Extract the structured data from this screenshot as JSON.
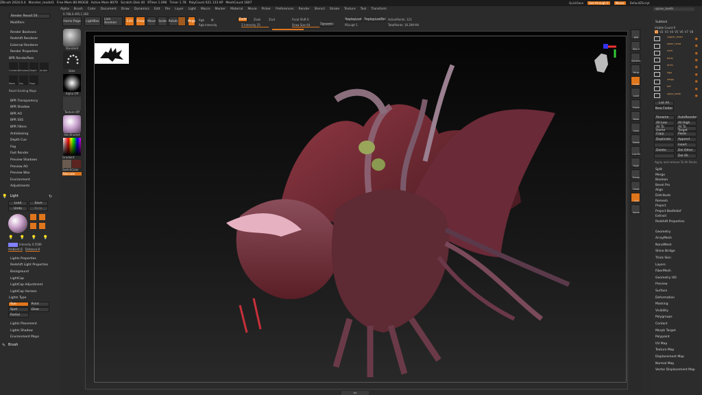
{
  "title_bar": {
    "items": [
      "ZBrush 2024.0.4",
      "Monster_model1",
      "Free Mem 80.993GB",
      "Active Mem 8079",
      "Scratch Disk 40",
      "RTime 1.096",
      "Timer 1.78",
      "PolyCount 621.133 KP",
      "MeshCount 1807"
    ],
    "right": [
      "QuickSave",
      "See-through 0",
      "Menus",
      "DefaultZScript"
    ]
  },
  "menubar": [
    "Alpha",
    "Brush",
    "Color",
    "Document",
    "Draw",
    "Dynamics",
    "Edit",
    "File",
    "Layer",
    "Light",
    "Macro",
    "Marker",
    "Material",
    "Movie",
    "Picker",
    "Preferences",
    "Render",
    "Stencil",
    "Stroke",
    "Texture",
    "Tool",
    "Transform",
    "ZPlugin",
    "ZScript",
    "Help"
  ],
  "coords": "0.768,0.495,1.268",
  "toolbar": {
    "home_page": "Home Page",
    "lightbox": "LightBox",
    "live_boolean": "Live Boolean",
    "edit": "Edit",
    "draw": "Draw",
    "move": "Move",
    "scale": "Scale",
    "rotate": "Rotate",
    "mrgb": "Mrgb",
    "rgb": "Rgb",
    "m": "M",
    "zadd": "Zadd",
    "zsub": "Zsub",
    "zcut": "Zcut",
    "rgb_intensity": "Rgb Intensity",
    "z_intensity": "Z Intensity 25",
    "focal_shift": "Focal Shift 0",
    "draw_size": "Draw Size 64",
    "dynamic": "Dynamic",
    "replay_last": "ReplayLast",
    "replay_last_rel": "ReplayLastRel",
    "polypaint": "PSculpt 1",
    "active_points": "ActivePoints: 121",
    "total_points": "TotalPoints: 16.299 Mil"
  },
  "left_panel": {
    "top_label": "Render Result 50",
    "modifiers": "Modifiers",
    "items_a": [
      "Render Booleans",
      "Redshift Renderer",
      "External Renderer",
      "Render Properties"
    ],
    "bpr_renderpass": "BPR RenderPass",
    "bpr_items": [
      "Combine",
      "Shadow",
      "Depth",
      "Ambie",
      "Mask",
      "Sss",
      "Floor",
      "Reset Existing Maps"
    ],
    "items_b": [
      "BPR Transparency",
      "BPR Shadow",
      "BPR AO",
      "BPR SSS",
      "BPR Filters",
      "Antialiasing",
      "Depth Cue",
      "Fog",
      "Fast Render",
      "Preview Shadows",
      "Preview AO",
      "Preview Wax",
      "Environment",
      "Adjustments"
    ],
    "light_title": "Light",
    "light_load": "Load",
    "light_save": "Save",
    "light_undo": "Undo",
    "light_redo": "Redo",
    "intensity": "Intensity 0.5589",
    "ambient": "Ambient 8",
    "distance": "Distance 8",
    "items_c": [
      "Lights Properties",
      "Redshift Light Properties",
      "Background",
      "LightCap",
      "LightCap Adjustment",
      "LightCap Horizon"
    ],
    "lights_type": "Lights Type",
    "type_buttons": [
      "Sun",
      "Point",
      "Spot",
      "Glow",
      "Radial"
    ],
    "items_d": [
      "Lights Placement",
      "Lights Shadow",
      "Environment Maps"
    ],
    "brush_title": "Brush"
  },
  "shelf": {
    "brush": "Standard",
    "stroke": "Dots",
    "alpha": "Alpha Off",
    "texture": "Texture Off",
    "material": "SkinShade4",
    "gradient": "Gradient",
    "switch_color": "SwitchColor",
    "alternate": "Alternate"
  },
  "right_shelf": [
    "BPR",
    "SPix 3",
    "Dynamic",
    "Persp",
    "Floor",
    "Local",
    "Frame",
    "Move",
    "Scale",
    "Rotate",
    "Line Fill",
    "PolyF",
    "Transp",
    "Ghost",
    "Solo",
    "Xpose"
  ],
  "right_panel": {
    "subtool": "Subtool",
    "visible_count": "Visible Count 9",
    "tabs": [
      "V1",
      "V2",
      "V3",
      "V4",
      "V5",
      "V6",
      "V7",
      "V8"
    ],
    "subtools": [
      "supper_head",
      "lower_head",
      "neck",
      "body",
      "arms",
      "legs",
      "wings",
      "tail",
      "spine_teeth"
    ],
    "list_all": "List All",
    "new_folder": "New Folder",
    "actions": [
      [
        "Rename",
        "AutoReorder"
      ],
      [
        "All Low",
        "All High"
      ],
      [
        "All To Home",
        "All To Target"
      ],
      [
        "Copy",
        "Paste"
      ],
      [
        "Duplicate",
        "Append"
      ],
      [
        "",
        "Insert"
      ],
      [
        "Delete",
        "Del Other"
      ],
      [
        "",
        "Del All"
      ]
    ],
    "merge": "Apply and remove To All Points",
    "items": [
      "Split",
      "Merge",
      "Boolean",
      "Bevel Pro",
      "Align",
      "Distribute",
      "Remesh",
      "Project",
      "Project BasRelief",
      "Extract",
      "Redshift Properties"
    ],
    "sections": [
      "Geometry",
      "ArrayMesh",
      "NanoMesh",
      "Shine Bridge",
      "Thick Skin",
      "Layers",
      "FiberMesh",
      "Geometry HD",
      "Preview",
      "Surface",
      "Deformation",
      "Masking",
      "Visibility",
      "Polygroups",
      "Contact",
      "Morph Target",
      "Polypaint",
      "UV Map",
      "Texture Map",
      "Displacement Map",
      "Normal Map",
      "Vector Displacement Map"
    ]
  },
  "colors": {
    "accent": "#e0761c",
    "panel": "#2c2c2c",
    "viewport_top": "#050505"
  }
}
